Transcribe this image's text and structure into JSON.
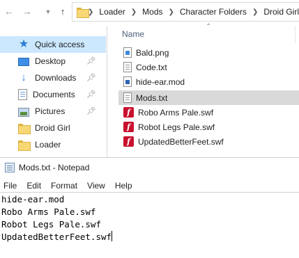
{
  "explorer": {
    "breadcrumb": [
      "Loader",
      "Mods",
      "Character Folders",
      "Droid Girl"
    ],
    "nav_items": [
      {
        "label": "Quick access",
        "icon": "star-icon",
        "selected": true,
        "pinned": false
      },
      {
        "label": "Desktop",
        "icon": "desktop-icon",
        "selected": false,
        "pinned": true
      },
      {
        "label": "Downloads",
        "icon": "download-icon",
        "selected": false,
        "pinned": true
      },
      {
        "label": "Documents",
        "icon": "documents-icon",
        "selected": false,
        "pinned": true
      },
      {
        "label": "Pictures",
        "icon": "pictures-icon",
        "selected": false,
        "pinned": true
      },
      {
        "label": "Droid Girl",
        "icon": "folder-icon",
        "selected": false,
        "pinned": false
      },
      {
        "label": "Loader",
        "icon": "folder-icon",
        "selected": false,
        "pinned": false
      }
    ],
    "column_header": "Name",
    "files": [
      {
        "name": "Bald.png",
        "icon": "png-file-icon",
        "selected": false
      },
      {
        "name": "Code.txt",
        "icon": "text-file-icon",
        "selected": false
      },
      {
        "name": "hide-ear.mod",
        "icon": "mod-file-icon",
        "selected": false
      },
      {
        "name": "Mods.txt",
        "icon": "text-file-icon",
        "selected": true
      },
      {
        "name": "Robo Arms Pale.swf",
        "icon": "flash-file-icon",
        "selected": false
      },
      {
        "name": "Robot Legs Pale.swf",
        "icon": "flash-file-icon",
        "selected": false
      },
      {
        "name": "UpdatedBetterFeet.swf",
        "icon": "flash-file-icon",
        "selected": false
      }
    ]
  },
  "notepad": {
    "title": "Mods.txt - Notepad",
    "menu": [
      "File",
      "Edit",
      "Format",
      "View",
      "Help"
    ],
    "lines": [
      "hide-ear.mod",
      "Robo Arms Pale.swf",
      "Robot Legs Pale.swf",
      "UpdatedBetterFeet.swf"
    ]
  },
  "colors": {
    "nav_selected": "#cce8ff",
    "file_selected": "#d9d9d9",
    "flash_red": "#c8102e",
    "folder_yellow": "#f8d775"
  }
}
